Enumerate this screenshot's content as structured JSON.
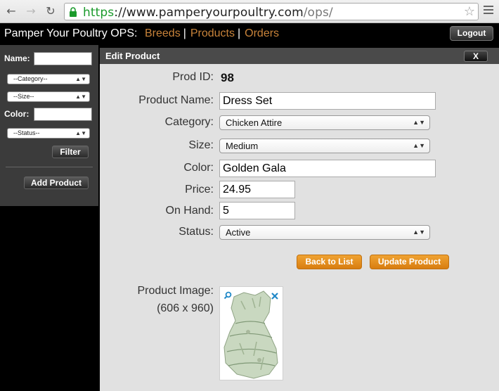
{
  "browser": {
    "url_scheme": "https",
    "url_sep": "://",
    "url_domain": "www.pamperyourpoultry.com",
    "url_path": "/ops/"
  },
  "app": {
    "brand": "Pamper Your Poultry OPS:",
    "nav": [
      "Breeds",
      "Products",
      "Orders"
    ],
    "logout_label": "Logout",
    "nav_color": "#c8833a"
  },
  "sidebar": {
    "name_label": "Name:",
    "category_placeholder": "--Category--",
    "size_placeholder": "--Size--",
    "color_label": "Color:",
    "status_placeholder": "--Status--",
    "filter_label": "Filter",
    "add_product_label": "Add Product"
  },
  "edit_product": {
    "title": "Edit Product",
    "close_label": "X",
    "prod_id_label": "Prod ID:",
    "prod_id": "98",
    "product_name_label": "Product Name:",
    "product_name": "Dress Set",
    "category_label": "Category:",
    "category": "Chicken Attire",
    "size_label": "Size:",
    "size": "Medium",
    "color_label": "Color:",
    "color": "Golden Gala",
    "price_label": "Price:",
    "price": "24.95",
    "on_hand_label": "On Hand:",
    "on_hand": "5",
    "status_label": "Status:",
    "status": "Active",
    "back_label": "Back to List",
    "update_label": "Update Product",
    "image_label": "Product Image:",
    "image_dims": "(606 x 960)",
    "button_color": "#e8901f"
  }
}
